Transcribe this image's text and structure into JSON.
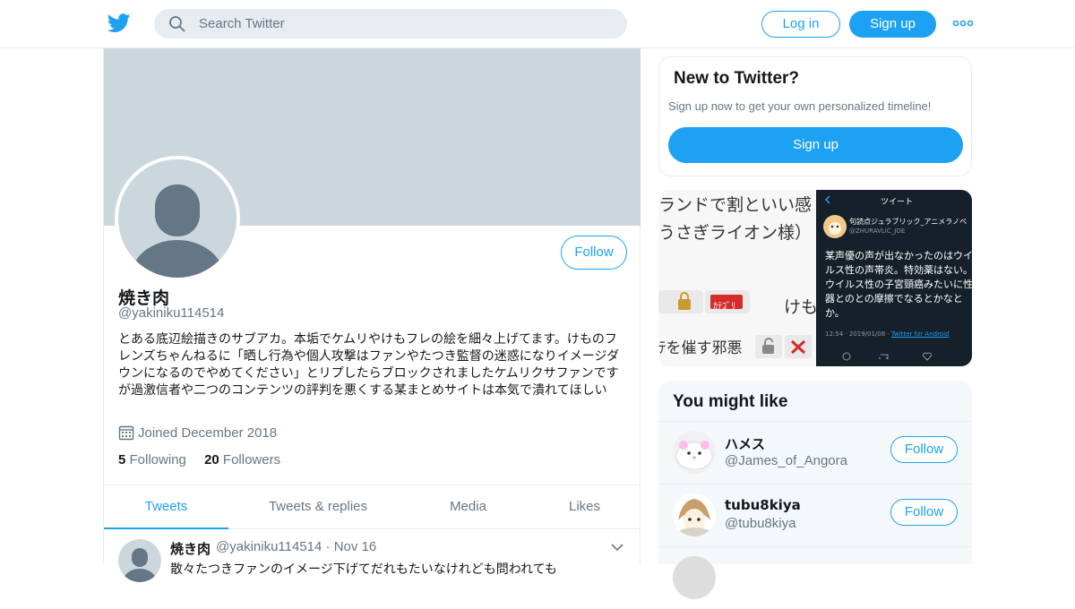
{
  "topbar": {
    "search_placeholder": "Search Twitter",
    "login_label": "Log in",
    "signup_label": "Sign up",
    "brand_color": "#1da1f2"
  },
  "profile": {
    "name": "焼き肉",
    "handle": "@yakiniku114514",
    "follow_label": "Follow",
    "bio": "とある底辺絵描きのサブアカ。本垢でケムリやけもフレの絵を細々上げてます。けものフレンズちゃんねるに「晒し行為や個人攻撃はファンやたつき監督の迷惑になりイメージダウンになるのでやめてください」とリプしたらブロックされましたケムリクサファンですが過激信者や二つのコンテンツの評判を悪くする某まとめサイトは本気で潰れてほしい",
    "joined": "Joined December 2018",
    "following_count": "5",
    "following_label": "Following",
    "followers_count": "20",
    "followers_label": "Followers"
  },
  "tabs": [
    {
      "label": "Tweets",
      "active": true
    },
    {
      "label": "Tweets & replies",
      "active": false
    },
    {
      "label": "Media",
      "active": false
    },
    {
      "label": "Likes",
      "active": false
    }
  ],
  "tweet": {
    "name": "焼き肉",
    "meta": "@yakiniku114514 · Nov 16",
    "text": "散々たつきファンのイメージ下げてだれもたいなけれども問われても"
  },
  "sidebar": {
    "new_title": "New to Twitter?",
    "new_subtitle": "Sign up now to get your own personalized timeline!",
    "new_signup": "Sign up",
    "media": {
      "left_line1": "ランドで割といい感",
      "left_line2": "うさぎライオン様）",
      "left_line3": "けも",
      "left_line4": "ﾃを催す邪悪",
      "tag": "ｶﾃｺﾞﾘ",
      "right_title": "ツイート",
      "right_name": "句読点ジュラブリック_アニメラノベ",
      "right_handle": "@ZHURAVLIC_JOE",
      "right_body": "某声優の声が出なかったのはウイルス性の声帯炎。特効薬はない。ウイルス性の子宮頸癌みたいに性器とのとの摩擦でなるとかなとか。",
      "right_date": "12:54 · 2019/01/08 · ",
      "right_via": "Twitter for Android"
    },
    "might_title": "You might like",
    "suggestions": [
      {
        "name": "ハメス",
        "handle": "@James_of_Angora",
        "follow": "Follow"
      },
      {
        "name": "tubu8kiya",
        "handle": "@tubu8kiya",
        "follow": "Follow"
      }
    ]
  }
}
